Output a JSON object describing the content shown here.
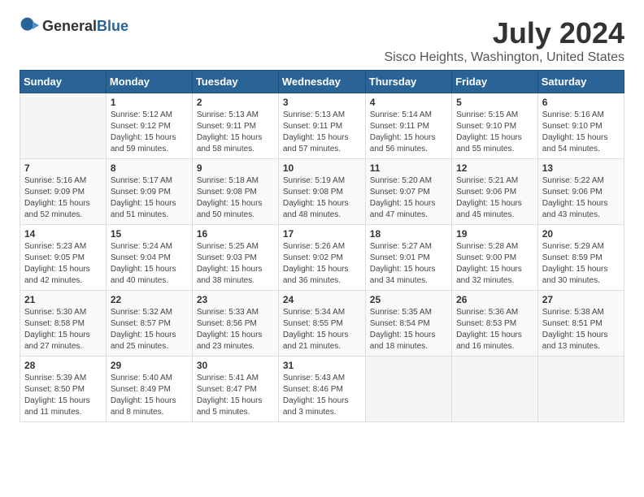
{
  "app": {
    "name_general": "General",
    "name_blue": "Blue"
  },
  "calendar": {
    "title": "July 2024",
    "subtitle": "Sisco Heights, Washington, United States",
    "days_header": [
      "Sunday",
      "Monday",
      "Tuesday",
      "Wednesday",
      "Thursday",
      "Friday",
      "Saturday"
    ],
    "weeks": [
      [
        {
          "day": "",
          "info": ""
        },
        {
          "day": "1",
          "info": "Sunrise: 5:12 AM\nSunset: 9:12 PM\nDaylight: 15 hours\nand 59 minutes."
        },
        {
          "day": "2",
          "info": "Sunrise: 5:13 AM\nSunset: 9:11 PM\nDaylight: 15 hours\nand 58 minutes."
        },
        {
          "day": "3",
          "info": "Sunrise: 5:13 AM\nSunset: 9:11 PM\nDaylight: 15 hours\nand 57 minutes."
        },
        {
          "day": "4",
          "info": "Sunrise: 5:14 AM\nSunset: 9:11 PM\nDaylight: 15 hours\nand 56 minutes."
        },
        {
          "day": "5",
          "info": "Sunrise: 5:15 AM\nSunset: 9:10 PM\nDaylight: 15 hours\nand 55 minutes."
        },
        {
          "day": "6",
          "info": "Sunrise: 5:16 AM\nSunset: 9:10 PM\nDaylight: 15 hours\nand 54 minutes."
        }
      ],
      [
        {
          "day": "7",
          "info": "Sunrise: 5:16 AM\nSunset: 9:09 PM\nDaylight: 15 hours\nand 52 minutes."
        },
        {
          "day": "8",
          "info": "Sunrise: 5:17 AM\nSunset: 9:09 PM\nDaylight: 15 hours\nand 51 minutes."
        },
        {
          "day": "9",
          "info": "Sunrise: 5:18 AM\nSunset: 9:08 PM\nDaylight: 15 hours\nand 50 minutes."
        },
        {
          "day": "10",
          "info": "Sunrise: 5:19 AM\nSunset: 9:08 PM\nDaylight: 15 hours\nand 48 minutes."
        },
        {
          "day": "11",
          "info": "Sunrise: 5:20 AM\nSunset: 9:07 PM\nDaylight: 15 hours\nand 47 minutes."
        },
        {
          "day": "12",
          "info": "Sunrise: 5:21 AM\nSunset: 9:06 PM\nDaylight: 15 hours\nand 45 minutes."
        },
        {
          "day": "13",
          "info": "Sunrise: 5:22 AM\nSunset: 9:06 PM\nDaylight: 15 hours\nand 43 minutes."
        }
      ],
      [
        {
          "day": "14",
          "info": "Sunrise: 5:23 AM\nSunset: 9:05 PM\nDaylight: 15 hours\nand 42 minutes."
        },
        {
          "day": "15",
          "info": "Sunrise: 5:24 AM\nSunset: 9:04 PM\nDaylight: 15 hours\nand 40 minutes."
        },
        {
          "day": "16",
          "info": "Sunrise: 5:25 AM\nSunset: 9:03 PM\nDaylight: 15 hours\nand 38 minutes."
        },
        {
          "day": "17",
          "info": "Sunrise: 5:26 AM\nSunset: 9:02 PM\nDaylight: 15 hours\nand 36 minutes."
        },
        {
          "day": "18",
          "info": "Sunrise: 5:27 AM\nSunset: 9:01 PM\nDaylight: 15 hours\nand 34 minutes."
        },
        {
          "day": "19",
          "info": "Sunrise: 5:28 AM\nSunset: 9:00 PM\nDaylight: 15 hours\nand 32 minutes."
        },
        {
          "day": "20",
          "info": "Sunrise: 5:29 AM\nSunset: 8:59 PM\nDaylight: 15 hours\nand 30 minutes."
        }
      ],
      [
        {
          "day": "21",
          "info": "Sunrise: 5:30 AM\nSunset: 8:58 PM\nDaylight: 15 hours\nand 27 minutes."
        },
        {
          "day": "22",
          "info": "Sunrise: 5:32 AM\nSunset: 8:57 PM\nDaylight: 15 hours\nand 25 minutes."
        },
        {
          "day": "23",
          "info": "Sunrise: 5:33 AM\nSunset: 8:56 PM\nDaylight: 15 hours\nand 23 minutes."
        },
        {
          "day": "24",
          "info": "Sunrise: 5:34 AM\nSunset: 8:55 PM\nDaylight: 15 hours\nand 21 minutes."
        },
        {
          "day": "25",
          "info": "Sunrise: 5:35 AM\nSunset: 8:54 PM\nDaylight: 15 hours\nand 18 minutes."
        },
        {
          "day": "26",
          "info": "Sunrise: 5:36 AM\nSunset: 8:53 PM\nDaylight: 15 hours\nand 16 minutes."
        },
        {
          "day": "27",
          "info": "Sunrise: 5:38 AM\nSunset: 8:51 PM\nDaylight: 15 hours\nand 13 minutes."
        }
      ],
      [
        {
          "day": "28",
          "info": "Sunrise: 5:39 AM\nSunset: 8:50 PM\nDaylight: 15 hours\nand 11 minutes."
        },
        {
          "day": "29",
          "info": "Sunrise: 5:40 AM\nSunset: 8:49 PM\nDaylight: 15 hours\nand 8 minutes."
        },
        {
          "day": "30",
          "info": "Sunrise: 5:41 AM\nSunset: 8:47 PM\nDaylight: 15 hours\nand 5 minutes."
        },
        {
          "day": "31",
          "info": "Sunrise: 5:43 AM\nSunset: 8:46 PM\nDaylight: 15 hours\nand 3 minutes."
        },
        {
          "day": "",
          "info": ""
        },
        {
          "day": "",
          "info": ""
        },
        {
          "day": "",
          "info": ""
        }
      ]
    ]
  }
}
